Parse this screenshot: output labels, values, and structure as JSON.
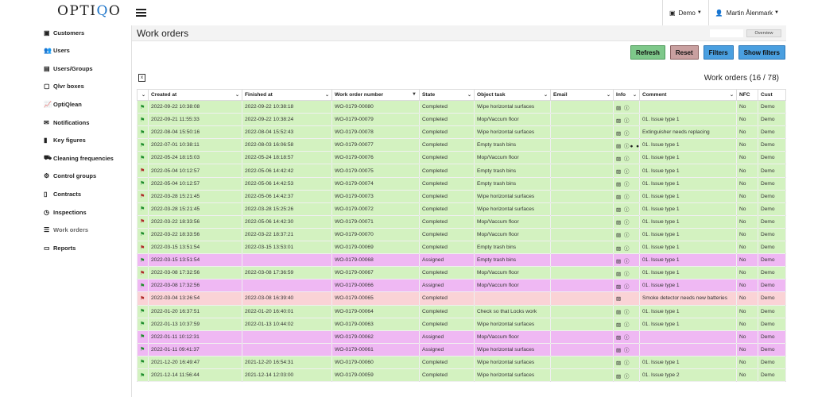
{
  "app": {
    "logo": "OPTIQO"
  },
  "topnav": {
    "org_label": "Demo",
    "user_label": "Martin Ålenmark"
  },
  "sidebar": {
    "items": [
      {
        "label": "Customers",
        "icon": "briefcase-icon",
        "glyph": "▣"
      },
      {
        "label": "Users",
        "icon": "users-icon",
        "glyph": "👥"
      },
      {
        "label": "Users/Groups",
        "icon": "id-card-icon",
        "glyph": "▤"
      },
      {
        "label": "Qlvr boxes",
        "icon": "box-icon",
        "glyph": "▢"
      },
      {
        "label": "OptiQlean",
        "icon": "chart-line-icon",
        "glyph": "📈"
      },
      {
        "label": "Notifications",
        "icon": "envelope-icon",
        "glyph": "✉"
      },
      {
        "label": "Key figures",
        "icon": "book-icon",
        "glyph": "▮"
      },
      {
        "label": "Cleaning frequencies",
        "icon": "truck-icon",
        "glyph": "⛟"
      },
      {
        "label": "Control groups",
        "icon": "sitemap-icon",
        "glyph": "⚙"
      },
      {
        "label": "Contracts",
        "icon": "file-icon",
        "glyph": "▯"
      },
      {
        "label": "Inspections",
        "icon": "clock-icon",
        "glyph": "◷"
      },
      {
        "label": "Work orders",
        "icon": "list-icon",
        "glyph": "☰"
      },
      {
        "label": "Reports",
        "icon": "monitor-icon",
        "glyph": "▭"
      }
    ]
  },
  "page": {
    "title": "Work orders",
    "overview_label": "Overview",
    "count_label": "Work orders (16 / 78)"
  },
  "buttons": {
    "refresh": "Refresh",
    "reset": "Reset",
    "filters": "Filters",
    "show_filters": "Show filters"
  },
  "table": {
    "columns": [
      "",
      "Created at",
      "Finished at",
      "Work order number",
      "State",
      "Object task",
      "Email",
      "Info",
      "Comment",
      "NFC",
      "Cust"
    ],
    "rows": [
      {
        "flag": "green",
        "created": "2022-09-22 10:38:08",
        "finished": "2022-09-22 10:38:18",
        "number": "WO-0179-00080",
        "state": "Completed",
        "task": "Wipe horizontal surfaces",
        "email": "",
        "info": "▨ ⓘ",
        "comment": "",
        "nfc": "No",
        "cust": "Demo",
        "style": "Completed"
      },
      {
        "flag": "green",
        "created": "2022-09-21 11:55:33",
        "finished": "2022-09-22 10:38:24",
        "number": "WO-0179-00079",
        "state": "Completed",
        "task": "Mop/Vaccum floor",
        "email": "",
        "info": "▨ ⓘ",
        "comment": "01. Issue type 1",
        "nfc": "No",
        "cust": "Demo",
        "style": "Completed"
      },
      {
        "flag": "green",
        "created": "2022-08-04 15:50:16",
        "finished": "2022-08-04 15:52:43",
        "number": "WO-0179-00078",
        "state": "Completed",
        "task": "Wipe horizontal surfaces",
        "email": "",
        "info": "▨ ⓘ",
        "comment": "Extinguisher needs replacing",
        "nfc": "No",
        "cust": "Demo",
        "style": "Completed"
      },
      {
        "flag": "green",
        "created": "2022-07-01 10:38:11",
        "finished": "2022-08-03 16:06:58",
        "number": "WO-0179-00077",
        "state": "Completed",
        "task": "Empty trash bins",
        "email": "",
        "info": "▨ ⓘ● ●",
        "comment": "01. Issue type 1",
        "nfc": "No",
        "cust": "Demo",
        "style": "Completed"
      },
      {
        "flag": "green",
        "created": "2022-05-24 18:15:03",
        "finished": "2022-05-24 18:18:57",
        "number": "WO-0179-00076",
        "state": "Completed",
        "task": "Mop/Vaccum floor",
        "email": "",
        "info": "▨ ⓘ",
        "comment": "01. Issue type 1",
        "nfc": "No",
        "cust": "Demo",
        "style": "Completed"
      },
      {
        "flag": "red",
        "created": "2022-05-04 10:12:57",
        "finished": "2022-05-06 14:42:42",
        "number": "WO-0179-00075",
        "state": "Completed",
        "task": "Empty trash bins",
        "email": "",
        "info": "▨ ⓘ",
        "comment": "01. Issue type 1",
        "nfc": "No",
        "cust": "Demo",
        "style": "Completed"
      },
      {
        "flag": "green",
        "created": "2022-05-04 10:12:57",
        "finished": "2022-05-06 14:42:53",
        "number": "WO-0179-00074",
        "state": "Completed",
        "task": "Empty trash bins",
        "email": "",
        "info": "▨ ⓘ",
        "comment": "01. Issue type 1",
        "nfc": "No",
        "cust": "Demo",
        "style": "Completed"
      },
      {
        "flag": "red",
        "created": "2022-03-28 15:21:45",
        "finished": "2022-05-06 14:42:37",
        "number": "WO-0179-00073",
        "state": "Completed",
        "task": "Wipe horizontal surfaces",
        "email": "",
        "info": "▨ ⓘ",
        "comment": "01. Issue type 1",
        "nfc": "No",
        "cust": "Demo",
        "style": "Completed"
      },
      {
        "flag": "green",
        "created": "2022-03-28 15:21:45",
        "finished": "2022-03-28 15:25:26",
        "number": "WO-0179-00072",
        "state": "Completed",
        "task": "Wipe horizontal surfaces",
        "email": "",
        "info": "▨ ⓘ",
        "comment": "01. Issue type 1",
        "nfc": "No",
        "cust": "Demo",
        "style": "Completed"
      },
      {
        "flag": "red",
        "created": "2022-03-22 18:33:56",
        "finished": "2022-05-06 14:42:30",
        "number": "WO-0179-00071",
        "state": "Completed",
        "task": "Mop/Vaccum floor",
        "email": "",
        "info": "▨ ⓘ",
        "comment": "01. Issue type 1",
        "nfc": "No",
        "cust": "Demo",
        "style": "Completed"
      },
      {
        "flag": "green",
        "created": "2022-03-22 18:33:56",
        "finished": "2022-03-22 18:37:21",
        "number": "WO-0179-00070",
        "state": "Completed",
        "task": "Mop/Vaccum floor",
        "email": "",
        "info": "▨ ⓘ",
        "comment": "01. Issue type 1",
        "nfc": "No",
        "cust": "Demo",
        "style": "Completed"
      },
      {
        "flag": "red",
        "created": "2022-03-15 13:51:54",
        "finished": "2022-03-15 13:53:01",
        "number": "WO-0179-00069",
        "state": "Completed",
        "task": "Empty trash bins",
        "email": "",
        "info": "▨ ⓘ",
        "comment": "01. Issue type 1",
        "nfc": "No",
        "cust": "Demo",
        "style": "Completed"
      },
      {
        "flag": "green",
        "created": "2022-03-15 13:51:54",
        "finished": "",
        "number": "WO-0179-00068",
        "state": "Assigned",
        "task": "Empty trash bins",
        "email": "",
        "info": "▨ ⓘ",
        "comment": "01. Issue type 1",
        "nfc": "No",
        "cust": "Demo",
        "style": "Assigned"
      },
      {
        "flag": "red",
        "created": "2022-03-08 17:32:56",
        "finished": "2022-03-08 17:36:59",
        "number": "WO-0179-00067",
        "state": "Completed",
        "task": "Mop/Vaccum floor",
        "email": "",
        "info": "▨ ⓘ",
        "comment": "01. Issue type 1",
        "nfc": "No",
        "cust": "Demo",
        "style": "Completed"
      },
      {
        "flag": "green",
        "created": "2022-03-08 17:32:56",
        "finished": "",
        "number": "WO-0179-00066",
        "state": "Assigned",
        "task": "Mop/Vaccum floor",
        "email": "",
        "info": "▨ ⓘ",
        "comment": "01. Issue type 1",
        "nfc": "No",
        "cust": "Demo",
        "style": "Assigned"
      },
      {
        "flag": "red",
        "created": "2022-03-04 13:26:54",
        "finished": "2022-03-08 16:39:40",
        "number": "WO-0179-00065",
        "state": "Completed",
        "task": "",
        "email": "",
        "info": "▨",
        "comment": "Smoke detector needs new batteries",
        "nfc": "No",
        "cust": "Demo",
        "style": "Pink"
      },
      {
        "flag": "green",
        "created": "2022-01-20 16:37:51",
        "finished": "2022-01-20 16:40:01",
        "number": "WO-0179-00064",
        "state": "Completed",
        "task": "Check so that Locks work",
        "email": "",
        "info": "▨ ⓘ",
        "comment": "01. Issue type 1",
        "nfc": "No",
        "cust": "Demo",
        "style": "Completed"
      },
      {
        "flag": "green",
        "created": "2022-01-13 10:37:59",
        "finished": "2022-01-13 10:44:02",
        "number": "WO-0179-00063",
        "state": "Completed",
        "task": "Wipe horizontal surfaces",
        "email": "",
        "info": "▨ ⓘ",
        "comment": "01. Issue type 1",
        "nfc": "No",
        "cust": "Demo",
        "style": "Completed"
      },
      {
        "flag": "green",
        "created": "2022-01-11 10:12:31",
        "finished": "",
        "number": "WO-0179-00062",
        "state": "Assigned",
        "task": "Mop/Vaccum floor",
        "email": "",
        "info": "▨ ⓘ",
        "comment": "",
        "nfc": "No",
        "cust": "Demo",
        "style": "Assigned"
      },
      {
        "flag": "green",
        "created": "2022-01-11 09:41:37",
        "finished": "",
        "number": "WO-0179-00061",
        "state": "Assigned",
        "task": "Wipe horizontal surfaces",
        "email": "",
        "info": "▨ ⓘ",
        "comment": "",
        "nfc": "No",
        "cust": "Demo",
        "style": "Assigned"
      },
      {
        "flag": "green",
        "created": "2021-12-20 16:49:47",
        "finished": "2021-12-20 16:54:31",
        "number": "WO-0179-00060",
        "state": "Completed",
        "task": "Wipe horizontal surfaces",
        "email": "",
        "info": "▨ ⓘ",
        "comment": "01. Issue type 1",
        "nfc": "No",
        "cust": "Demo",
        "style": "Completed"
      },
      {
        "flag": "green",
        "created": "2021-12-14 11:56:44",
        "finished": "2021-12-14 12:03:00",
        "number": "WO-0179-00059",
        "state": "Completed",
        "task": "Wipe horizontal surfaces",
        "email": "",
        "info": "▨ ⓘ",
        "comment": "01. Issue type 2",
        "nfc": "No",
        "cust": "Demo",
        "style": "Completed"
      }
    ]
  },
  "colors": {
    "completed_row": "#d3f2c0",
    "assigned_row": "#efb8f3",
    "flagged_row": "#fad3d6",
    "refresh_button": "#7ec88a",
    "reset_button": "#c9a0a0",
    "filters_button": "#4a9fe0"
  }
}
